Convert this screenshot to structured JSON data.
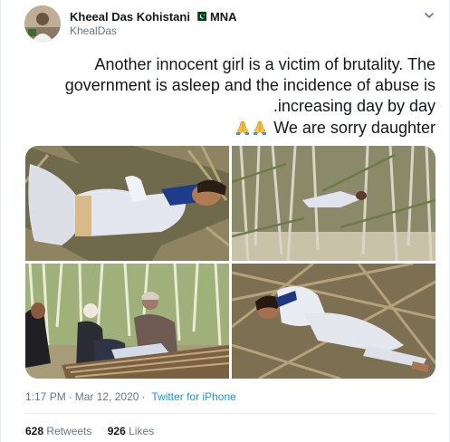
{
  "author": {
    "display_name": "Kheeal Das Kohistani",
    "suffix": "MNA",
    "handle": "KhealDas",
    "flag_icon": "pakistan-flag-icon"
  },
  "tweet": {
    "lines": [
      "Another innocent girl is a victim of brutality. The",
      "government is asleep and the incidence of abuse is",
      ".increasing day by day",
      "We are sorry daughter"
    ],
    "emoji": "folded-hands-icon"
  },
  "media": {
    "photo_count": 4
  },
  "meta": {
    "time": "1:17 PM",
    "separator": "·",
    "date": "Mar 12, 2020",
    "source": "Twitter for iPhone"
  },
  "stats": {
    "retweets_count": "628",
    "retweets_label": "Retweets",
    "likes_count": "926",
    "likes_label": "Likes"
  },
  "colors": {
    "text": "#14171a",
    "secondary": "#657786",
    "link": "#1b95e0",
    "border": "#e6ecf0"
  }
}
